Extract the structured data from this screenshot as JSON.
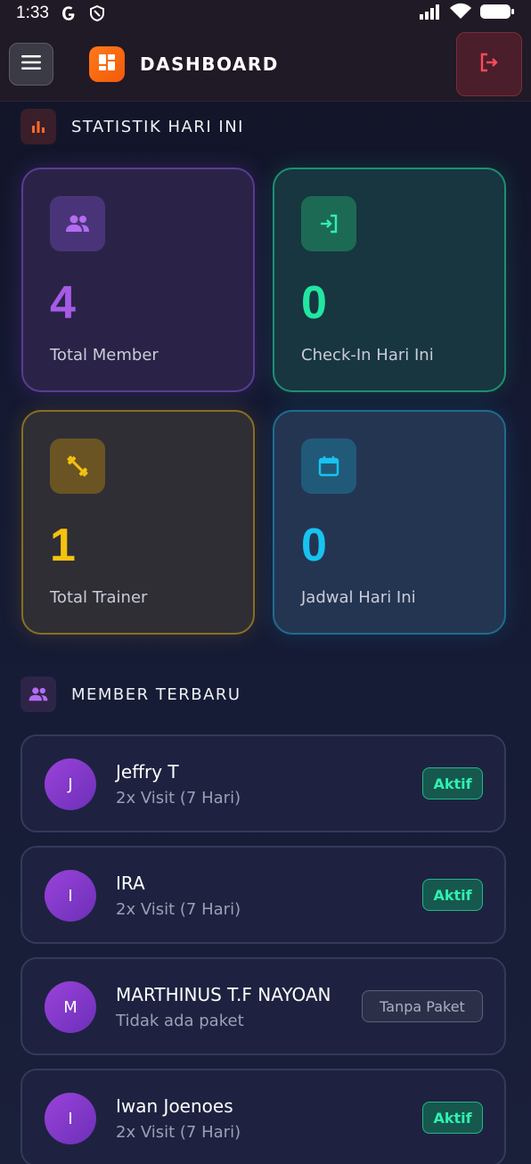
{
  "status_bar": {
    "time": "1:33",
    "left_icons": [
      "google-icon",
      "shield-icon"
    ],
    "right_icons": [
      "signal-icon",
      "wifi-icon",
      "battery-icon"
    ]
  },
  "header": {
    "title": "DASHBOARD",
    "menu_icon": "hamburger-icon",
    "logo_icon": "dashboard-grid-icon",
    "logout_icon": "logout-icon"
  },
  "stats_section": {
    "title": "STATISTIK HARI INI",
    "icon": "bar-chart-icon"
  },
  "stats": [
    {
      "value": "4",
      "label": "Total Member",
      "icon": "group-icon",
      "color": "#a55be6"
    },
    {
      "value": "0",
      "label": "Check-In Hari Ini",
      "icon": "login-icon",
      "color": "#21e6a2"
    },
    {
      "value": "1",
      "label": "Total Trainer",
      "icon": "dumbbell-icon",
      "color": "#f4c20f"
    },
    {
      "value": "0",
      "label": "Jadwal Hari Ini",
      "icon": "calendar-icon",
      "color": "#18c3ef"
    }
  ],
  "members_section": {
    "title": "MEMBER TERBARU",
    "icon": "group-icon"
  },
  "members": [
    {
      "initial": "J",
      "name": "Jeffry T",
      "sub": "2x Visit (7 Hari)",
      "badge": "Aktif",
      "status": "active"
    },
    {
      "initial": "I",
      "name": "IRA",
      "sub": "2x Visit (7 Hari)",
      "badge": "Aktif",
      "status": "active"
    },
    {
      "initial": "M",
      "name": "MARTHINUS T.F NAYOAN",
      "sub": "Tidak ada paket",
      "badge": "Tanpa Paket",
      "status": "none"
    },
    {
      "initial": "I",
      "name": "Iwan Joenoes",
      "sub": "2x Visit (7 Hari)",
      "badge": "Aktif",
      "status": "active"
    }
  ]
}
